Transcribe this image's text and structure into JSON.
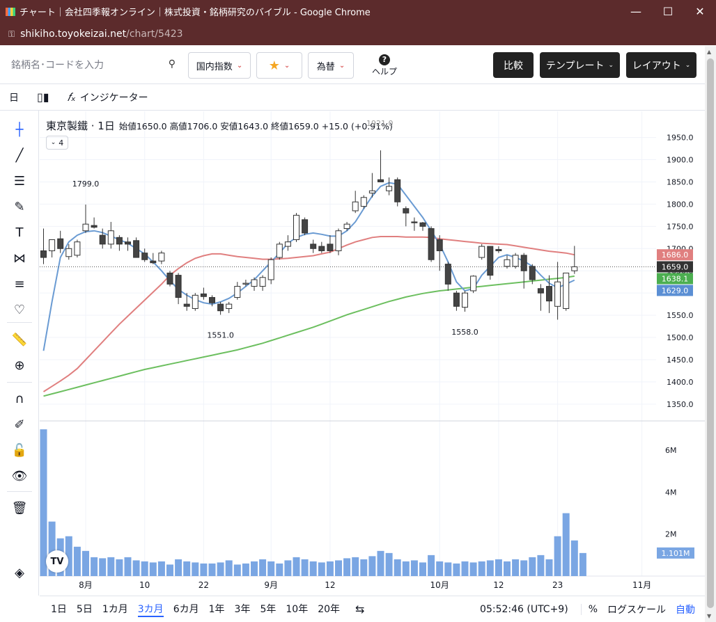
{
  "window": {
    "title": "チャート｜会社四季報オンライン｜株式投資・銘柄研究のバイブル - Google Chrome",
    "minimize": "—",
    "maximize": "☐",
    "close": "✕"
  },
  "address": {
    "host": "shikiho.toyokeizai.net",
    "path": "/chart/5423"
  },
  "topbar": {
    "search_placeholder": "銘柄名･コードを入力",
    "index_label": "国内指数",
    "fx_label": "為替",
    "help_label": "ヘルプ",
    "compare_label": "比較",
    "template_label": "テンプレート",
    "layout_label": "レイアウト"
  },
  "toolbar2": {
    "interval": "日",
    "indicator_label": "インジケーター"
  },
  "legend": {
    "symbol": "東京製鐵 · 1日",
    "ohlc": "始値1650.0 高値1706.0 安値1643.0 終値1659.0 +15.0 (+0.91%)",
    "overlay_text": "1921.0",
    "indicator_count": "4"
  },
  "bottombar": {
    "ranges": [
      "1日",
      "5日",
      "1カ月",
      "3カ月",
      "6カ月",
      "1年",
      "3年",
      "5年",
      "10年",
      "20年"
    ],
    "active_range": "3カ月",
    "clock": "05:52:46 (UTC+9)",
    "percent": "%",
    "log_scale": "ログスケール",
    "auto": "自動"
  },
  "colors": {
    "ma_short": "#6a9bd3",
    "ma_mid": "#e07f7f",
    "ma_long": "#6cbf5f",
    "volume": "#7aa6e3",
    "candle_up": "#ffffff",
    "candle_down": "#444444"
  },
  "chart_data": {
    "type": "candlestick",
    "y_ticks": [
      "1950.0",
      "1900.0",
      "1850.0",
      "1800.0",
      "1750.0",
      "1700.0",
      "1650.0",
      "1600.0",
      "1550.0",
      "1500.0",
      "1450.0",
      "1400.0",
      "1350.0"
    ],
    "ylim": [
      1320,
      1965
    ],
    "x_labels": [
      {
        "i": 5,
        "label": "8月"
      },
      {
        "i": 12,
        "label": "10"
      },
      {
        "i": 19,
        "label": "22"
      },
      {
        "i": 27,
        "label": "9月"
      },
      {
        "i": 34,
        "label": "12"
      },
      {
        "i": 47,
        "label": "10月"
      },
      {
        "i": 54,
        "label": "12"
      },
      {
        "i": 61,
        "label": "23"
      },
      {
        "i": 71,
        "label": "11月"
      }
    ],
    "n_slots": 76,
    "candles": [
      {
        "o": 1695,
        "h": 1745,
        "l": 1665,
        "c": 1680
      },
      {
        "o": 1695,
        "h": 1720,
        "l": 1680,
        "c": 1720
      },
      {
        "o": 1722,
        "h": 1740,
        "l": 1690,
        "c": 1700
      },
      {
        "o": 1682,
        "h": 1710,
        "l": 1675,
        "c": 1700
      },
      {
        "o": 1685,
        "h": 1720,
        "l": 1680,
        "c": 1715
      },
      {
        "o": 1740,
        "h": 1799,
        "l": 1735,
        "c": 1755
      },
      {
        "o": 1752,
        "h": 1770,
        "l": 1745,
        "c": 1748
      },
      {
        "o": 1730,
        "h": 1745,
        "l": 1700,
        "c": 1710
      },
      {
        "o": 1710,
        "h": 1760,
        "l": 1700,
        "c": 1740
      },
      {
        "o": 1725,
        "h": 1730,
        "l": 1695,
        "c": 1710
      },
      {
        "o": 1715,
        "h": 1725,
        "l": 1695,
        "c": 1710
      },
      {
        "o": 1718,
        "h": 1725,
        "l": 1680,
        "c": 1680
      },
      {
        "o": 1690,
        "h": 1700,
        "l": 1670,
        "c": 1675
      },
      {
        "o": 1672,
        "h": 1690,
        "l": 1665,
        "c": 1668
      },
      {
        "o": 1672,
        "h": 1695,
        "l": 1665,
        "c": 1690
      },
      {
        "o": 1645,
        "h": 1650,
        "l": 1615,
        "c": 1620
      },
      {
        "o": 1640,
        "h": 1645,
        "l": 1575,
        "c": 1590
      },
      {
        "o": 1575,
        "h": 1600,
        "l": 1560,
        "c": 1570
      },
      {
        "o": 1565,
        "h": 1600,
        "l": 1560,
        "c": 1595
      },
      {
        "o": 1598,
        "h": 1612,
        "l": 1585,
        "c": 1592
      },
      {
        "o": 1590,
        "h": 1595,
        "l": 1570,
        "c": 1578
      },
      {
        "o": 1575,
        "h": 1580,
        "l": 1551,
        "c": 1560
      },
      {
        "o": 1565,
        "h": 1580,
        "l": 1555,
        "c": 1575
      },
      {
        "o": 1590,
        "h": 1625,
        "l": 1585,
        "c": 1615
      },
      {
        "o": 1620,
        "h": 1630,
        "l": 1615,
        "c": 1622
      },
      {
        "o": 1615,
        "h": 1635,
        "l": 1605,
        "c": 1630
      },
      {
        "o": 1615,
        "h": 1640,
        "l": 1605,
        "c": 1635
      },
      {
        "o": 1630,
        "h": 1680,
        "l": 1620,
        "c": 1675
      },
      {
        "o": 1680,
        "h": 1715,
        "l": 1675,
        "c": 1710
      },
      {
        "o": 1705,
        "h": 1730,
        "l": 1695,
        "c": 1715
      },
      {
        "o": 1720,
        "h": 1780,
        "l": 1715,
        "c": 1775
      },
      {
        "o": 1765,
        "h": 1770,
        "l": 1730,
        "c": 1735
      },
      {
        "o": 1710,
        "h": 1720,
        "l": 1690,
        "c": 1700
      },
      {
        "o": 1705,
        "h": 1715,
        "l": 1690,
        "c": 1695
      },
      {
        "o": 1710,
        "h": 1730,
        "l": 1690,
        "c": 1695
      },
      {
        "o": 1695,
        "h": 1745,
        "l": 1685,
        "c": 1740
      },
      {
        "o": 1745,
        "h": 1760,
        "l": 1740,
        "c": 1755
      },
      {
        "o": 1785,
        "h": 1830,
        "l": 1780,
        "c": 1805
      },
      {
        "o": 1795,
        "h": 1820,
        "l": 1790,
        "c": 1815
      },
      {
        "o": 1825,
        "h": 1870,
        "l": 1815,
        "c": 1830
      },
      {
        "o": 1855,
        "h": 1921,
        "l": 1850,
        "c": 1850
      },
      {
        "o": 1830,
        "h": 1860,
        "l": 1820,
        "c": 1840
      },
      {
        "o": 1855,
        "h": 1860,
        "l": 1795,
        "c": 1805
      },
      {
        "o": 1790,
        "h": 1795,
        "l": 1750,
        "c": 1780
      },
      {
        "o": 1760,
        "h": 1770,
        "l": 1740,
        "c": 1758
      },
      {
        "o": 1758,
        "h": 1760,
        "l": 1740,
        "c": 1750
      },
      {
        "o": 1745,
        "h": 1750,
        "l": 1670,
        "c": 1675
      },
      {
        "o": 1720,
        "h": 1730,
        "l": 1650,
        "c": 1695
      },
      {
        "o": 1665,
        "h": 1670,
        "l": 1605,
        "c": 1620
      },
      {
        "o": 1600,
        "h": 1605,
        "l": 1560,
        "c": 1570
      },
      {
        "o": 1568,
        "h": 1605,
        "l": 1558,
        "c": 1600
      },
      {
        "o": 1605,
        "h": 1640,
        "l": 1600,
        "c": 1638
      },
      {
        "o": 1680,
        "h": 1710,
        "l": 1675,
        "c": 1705
      },
      {
        "o": 1705,
        "h": 1705,
        "l": 1630,
        "c": 1640
      },
      {
        "o": 1698,
        "h": 1705,
        "l": 1690,
        "c": 1695
      },
      {
        "o": 1660,
        "h": 1685,
        "l": 1655,
        "c": 1675
      },
      {
        "o": 1660,
        "h": 1690,
        "l": 1655,
        "c": 1685
      },
      {
        "o": 1685,
        "h": 1690,
        "l": 1610,
        "c": 1650
      },
      {
        "o": 1660,
        "h": 1665,
        "l": 1620,
        "c": 1630
      },
      {
        "o": 1610,
        "h": 1620,
        "l": 1560,
        "c": 1600
      },
      {
        "o": 1615,
        "h": 1640,
        "l": 1555,
        "c": 1582
      },
      {
        "o": 1570,
        "h": 1670,
        "l": 1540,
        "c": 1625
      },
      {
        "o": 1565,
        "h": 1640,
        "l": 1560,
        "c": 1645
      },
      {
        "o": 1650,
        "h": 1706,
        "l": 1643,
        "c": 1659
      }
    ],
    "ma_short": [
      1470,
      1580,
      1680,
      1715,
      1730,
      1738,
      1740,
      1736,
      1728,
      1720,
      1712,
      1700,
      1688,
      1670,
      1650,
      1628,
      1608,
      1595,
      1585,
      1578,
      1575,
      1580,
      1588,
      1600,
      1615,
      1630,
      1650,
      1670,
      1690,
      1712,
      1725,
      1732,
      1735,
      1732,
      1728,
      1728,
      1740,
      1760,
      1790,
      1818,
      1840,
      1848,
      1845,
      1820,
      1795,
      1770,
      1740,
      1710,
      1670,
      1625,
      1605,
      1610,
      1640,
      1660,
      1680,
      1686,
      1680,
      1672,
      1660,
      1640,
      1622,
      1612,
      1620,
      1629
    ],
    "ma_mid": [
      1378,
      1390,
      1402,
      1415,
      1430,
      1450,
      1470,
      1490,
      1510,
      1530,
      1548,
      1566,
      1584,
      1602,
      1620,
      1640,
      1655,
      1668,
      1678,
      1684,
      1688,
      1688,
      1685,
      1682,
      1680,
      1678,
      1676,
      1676,
      1677,
      1678,
      1680,
      1682,
      1684,
      1688,
      1692,
      1700,
      1708,
      1715,
      1720,
      1725,
      1727,
      1727,
      1727,
      1726,
      1726,
      1726,
      1725,
      1722,
      1720,
      1718,
      1716,
      1714,
      1712,
      1711,
      1710,
      1709,
      1706,
      1703,
      1700,
      1697,
      1694,
      1692,
      1690,
      1686
    ],
    "ma_long": [
      1368,
      1373,
      1378,
      1383,
      1388,
      1393,
      1398,
      1403,
      1408,
      1413,
      1418,
      1423,
      1428,
      1432,
      1436,
      1440,
      1444,
      1448,
      1452,
      1456,
      1460,
      1464,
      1468,
      1472,
      1477,
      1482,
      1487,
      1493,
      1499,
      1505,
      1511,
      1517,
      1523,
      1530,
      1537,
      1544,
      1551,
      1557,
      1563,
      1569,
      1575,
      1581,
      1586,
      1591,
      1595,
      1599,
      1602,
      1605,
      1607,
      1609,
      1611,
      1613,
      1615,
      1617,
      1619,
      1621,
      1623,
      1625,
      1627,
      1629,
      1631,
      1633,
      1635,
      1638
    ],
    "price_labels": [
      {
        "value": 1686.0,
        "text": "1686.0",
        "color": "#e07f7f"
      },
      {
        "value": 1659.0,
        "text": "1659.0",
        "color": "#333333"
      },
      {
        "value": 1638.1,
        "text": "1638.1",
        "color": "#4caf50"
      },
      {
        "value": 1629.0,
        "text": "1629.0",
        "color": "#5b8fd4"
      }
    ],
    "annotations": [
      {
        "i": 5,
        "value": 1799.0,
        "text": "1799.0",
        "pos": "above"
      },
      {
        "i": 21,
        "value": 1551.0,
        "text": "1551.0",
        "pos": "below"
      },
      {
        "i": 50,
        "value": 1558.0,
        "text": "1558.0",
        "pos": "below"
      }
    ],
    "last_price": 1659.0,
    "volume": {
      "y_ticks": [
        "6M",
        "4M",
        "2M"
      ],
      "ylim": [
        0,
        7.4
      ],
      "last_label": "1.101M",
      "values": [
        7.0,
        2.6,
        1.8,
        1.9,
        1.4,
        1.2,
        0.9,
        0.85,
        0.9,
        0.8,
        0.9,
        0.75,
        0.7,
        0.65,
        0.7,
        0.55,
        0.8,
        0.7,
        0.65,
        0.6,
        0.6,
        0.65,
        0.75,
        0.55,
        0.6,
        0.7,
        0.8,
        0.7,
        0.6,
        0.75,
        0.9,
        0.8,
        0.7,
        0.65,
        0.7,
        0.75,
        0.85,
        0.9,
        0.8,
        0.95,
        1.2,
        1.1,
        0.8,
        0.7,
        0.75,
        0.65,
        1.0,
        0.7,
        0.65,
        0.6,
        0.7,
        0.65,
        0.7,
        0.75,
        0.8,
        0.7,
        0.8,
        0.75,
        0.9,
        1.0,
        0.8,
        1.9,
        3.0,
        1.7,
        1.1
      ]
    }
  }
}
